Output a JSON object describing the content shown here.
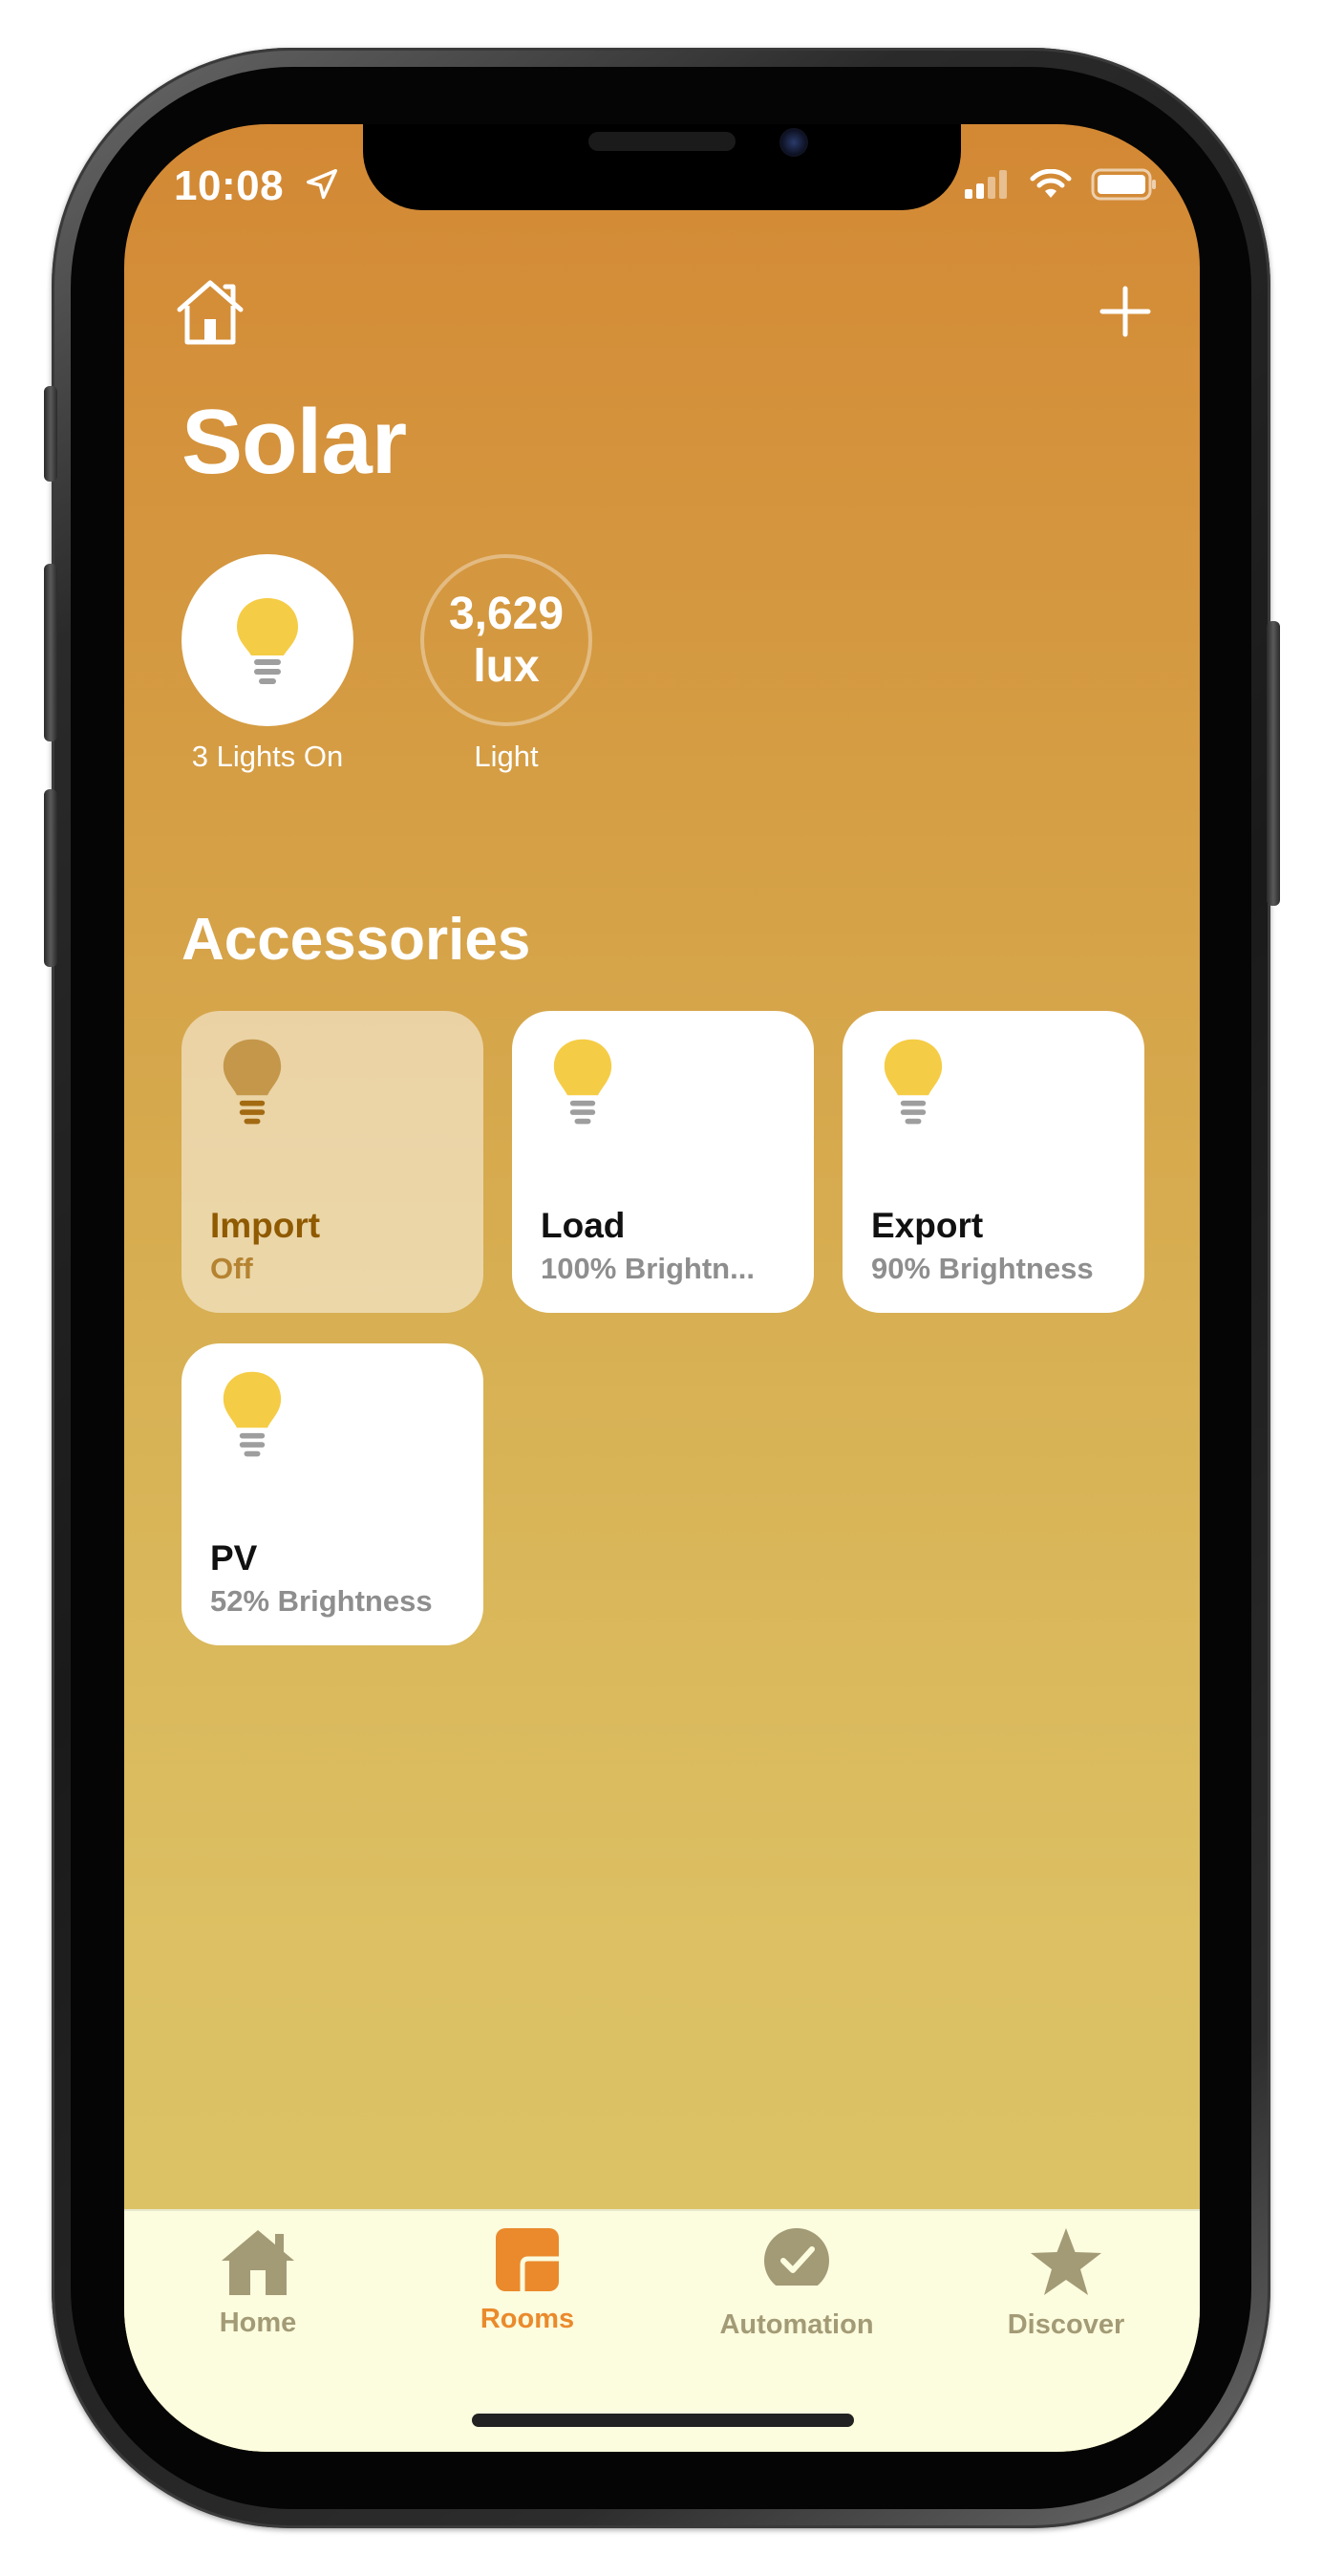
{
  "status_bar": {
    "time": "10:08"
  },
  "header": {
    "title": "Solar"
  },
  "summary": {
    "lights": {
      "label": "3 Lights On"
    },
    "lux": {
      "value": "3,629",
      "unit": "lux",
      "label": "Light"
    }
  },
  "accessories": {
    "title": "Accessories",
    "tiles": [
      {
        "name": "Import",
        "state": "Off",
        "on": false
      },
      {
        "name": "Load",
        "state": "100% Brightn...",
        "on": true
      },
      {
        "name": "Export",
        "state": "90% Brightness",
        "on": true
      },
      {
        "name": "PV",
        "state": "52% Brightness",
        "on": true
      }
    ]
  },
  "tabbar": {
    "tabs": [
      {
        "label": "Home",
        "icon": "home-icon"
      },
      {
        "label": "Rooms",
        "icon": "rooms-icon",
        "active": true
      },
      {
        "label": "Automation",
        "icon": "automation-icon"
      },
      {
        "label": "Discover",
        "icon": "star-icon"
      }
    ]
  },
  "colors": {
    "gradient_top": "#d38834",
    "gradient_bottom": "#dcc466",
    "bulb_on": "#f5cc45",
    "bulb_off": "#c4974a",
    "tab_active": "#ea8a2c",
    "tab_inactive": "#a39b76",
    "tabbar_bg": "#fcfcde"
  }
}
